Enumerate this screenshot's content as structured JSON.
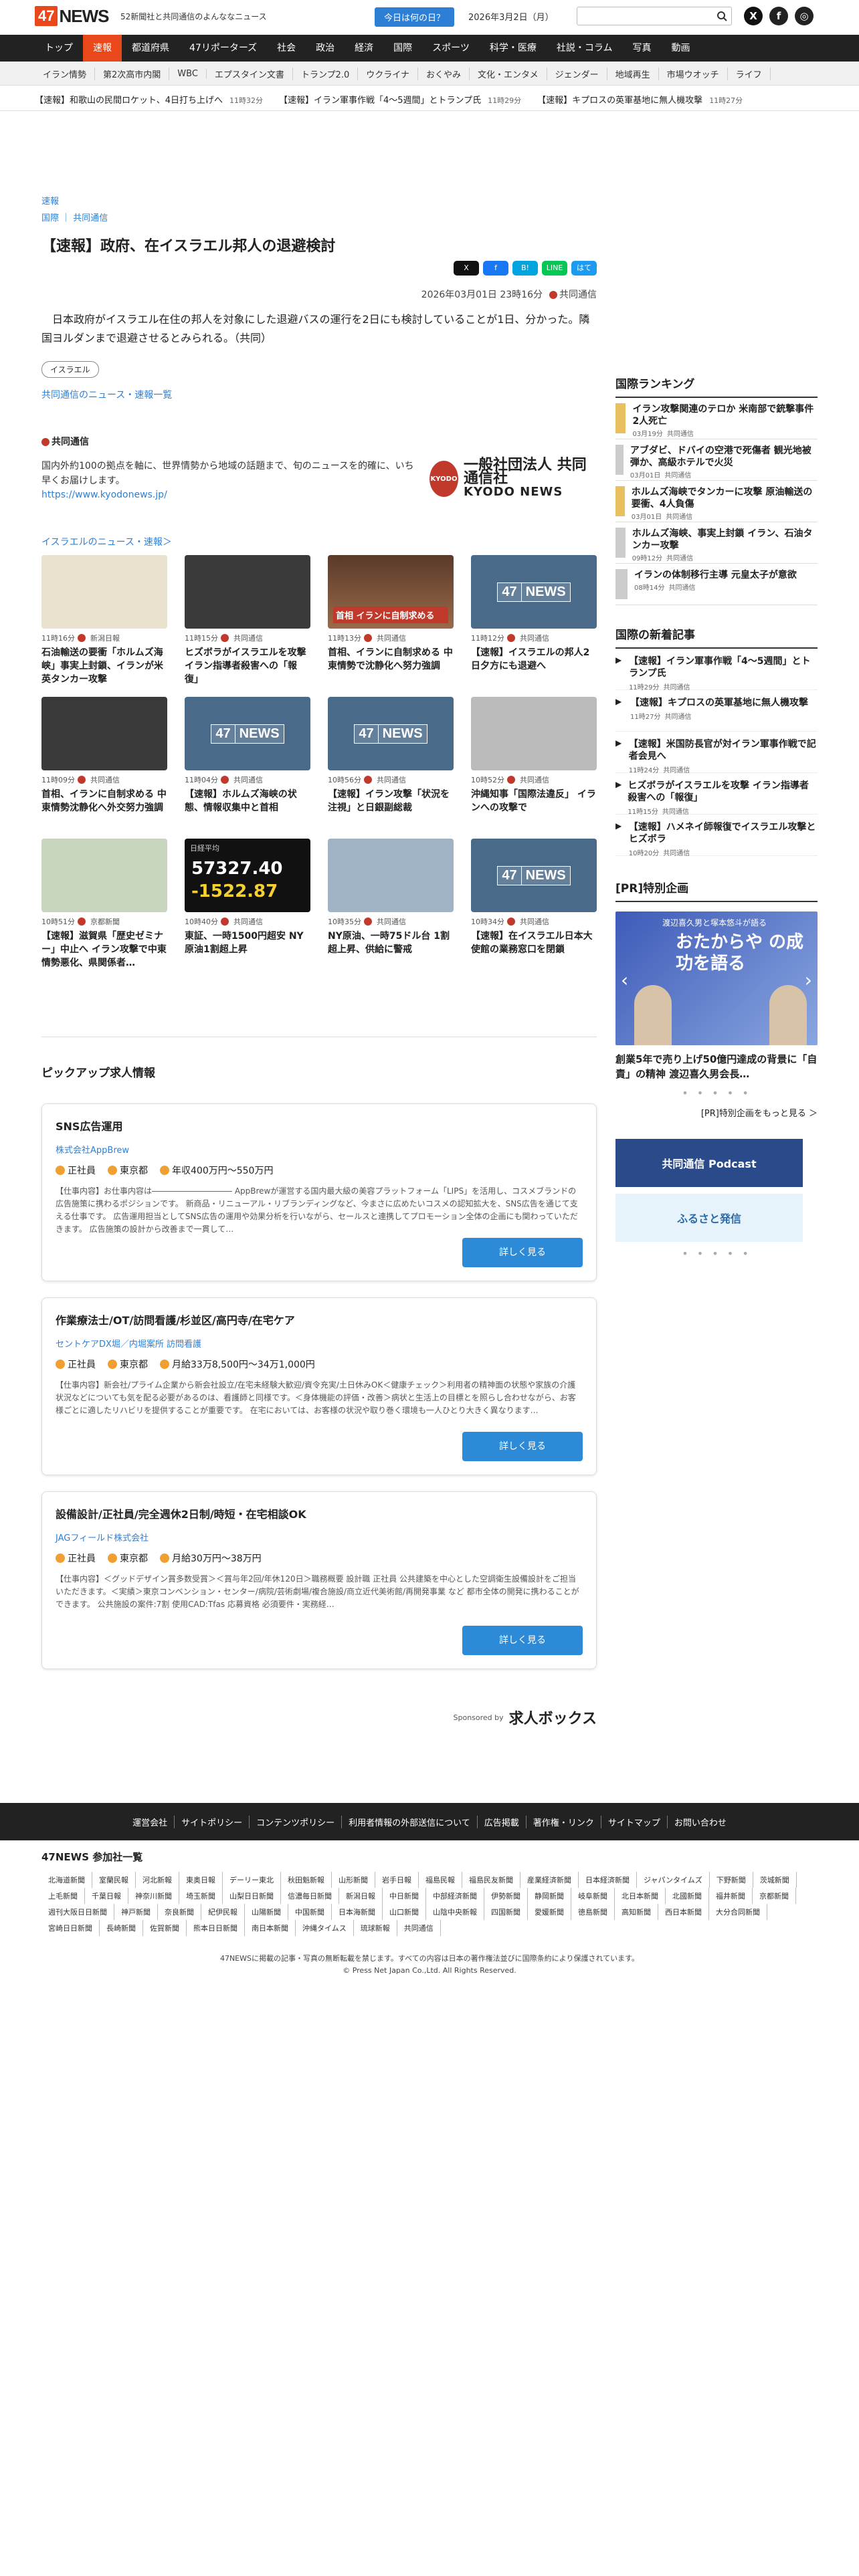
{
  "header": {
    "brand_a": "47",
    "brand_b": "NEWS",
    "tagline": "52新聞社と共同通信のよんななニュース",
    "day_button": "今日は何の日？",
    "date": "2026年3月2日（月）",
    "search_placeholder": ""
  },
  "nav": [
    "トップ",
    "速報",
    "都道府県",
    "47リポーターズ",
    "社会",
    "政治",
    "経済",
    "国際",
    "スポーツ",
    "科学・医療",
    "社説・コラム",
    "写真",
    "動画"
  ],
  "subnav": [
    "イラン情勢",
    "第2次高市内閣",
    "WBC",
    "エプスタイン文書",
    "トランプ2.0",
    "ウクライナ",
    "おくやみ",
    "文化・エンタメ",
    "ジェンダー",
    "地域再生",
    "市場ウオッチ",
    "ライフ"
  ],
  "ticker": [
    {
      "t": "【速報】和歌山の民間ロケット、4日打ち上げへ",
      "tm": "11時32分"
    },
    {
      "t": "【速報】イラン軍事作戦「4～5週間」とトランプ氏",
      "tm": "11時29分"
    },
    {
      "t": "【速報】キプロスの英軍基地に無人機攻撃",
      "tm": "11時27分"
    }
  ],
  "article": {
    "category": "速報",
    "sub_a": "国際",
    "sub_b": "共同通信",
    "title": "【速報】政府、在イスラエル邦人の退避検討",
    "date": "2026年03月01日 23時16分",
    "source": "共同通信",
    "body": "日本政府がイスラエル在住の邦人を対象にした退避バスの運行を2日にも検討していることが1日、分かった。隣国ヨルダンまで退避させるとみられる。（共同）",
    "tag": "イスラエル",
    "news_link": "共同通信のニュース・速報一覧"
  },
  "share": [
    "X",
    "f",
    "B!",
    "LINE",
    "はて"
  ],
  "source_box": {
    "name": "共同通信",
    "desc": "国内外約100の拠点を軸に、世界情勢から地域の話題まで、旬のニュースを的確に、いち早くお届けします。",
    "url": "https://www.kyodonews.jp/",
    "logo_small": "KYODO",
    "logo_a": "一般社団法人 共同通信社",
    "logo_b": "KYODO NEWS"
  },
  "related_title": "イスラエルのニュース・速報＞",
  "related": [
    {
      "time": "11時16分",
      "src": "新潟日報",
      "title": "石油輸送の要衝「ホルムズ海峡」事実上封鎖、イランが米英タンカー攻撃",
      "kind": "map"
    },
    {
      "time": "11時15分",
      "src": "共同通信",
      "title": "ヒズボラがイスラエルを攻撃 イラン指導者殺害への「報復」",
      "kind": "dark"
    },
    {
      "time": "11時13分",
      "src": "共同通信",
      "title": "首相、イランに自制求める 中東情勢で沈静化へ努力強調",
      "kind": "red"
    },
    {
      "time": "11時12分",
      "src": "共同通信",
      "title": "【速報】イスラエルの邦人2日夕方にも退避へ",
      "kind": "logo"
    },
    {
      "time": "11時09分",
      "src": "共同通信",
      "title": "首相、イランに自制求める 中東情勢沈静化へ外交努力強調",
      "kind": "dark"
    },
    {
      "time": "11時04分",
      "src": "共同通信",
      "title": "【速報】ホルムズ海峡の状態、情報収集中と首相",
      "kind": "logo"
    },
    {
      "time": "10時56分",
      "src": "共同通信",
      "title": "【速報】イラン攻撃「状況を注視」と日銀副総裁",
      "kind": "logo"
    },
    {
      "time": "10時52分",
      "src": "共同通信",
      "title": "沖縄知事「国際法違反」 イランへの攻撃で",
      "kind": "gray"
    },
    {
      "time": "10時51分",
      "src": "京都新聞",
      "title": "【速報】滋賀県「歴史ゼミナー」中止へ イラン攻撃で中東情勢悪化、県関係者…",
      "kind": "bldg"
    },
    {
      "time": "10時40分",
      "src": "共同通信",
      "title": "東証、一時1500円超安 NY原油1割超上昇",
      "kind": "stock"
    },
    {
      "time": "10時35分",
      "src": "共同通信",
      "title": "NY原油、一時75ドル台 1割超上昇、供給に警戒",
      "kind": "sea"
    },
    {
      "time": "10時34分",
      "src": "共同通信",
      "title": "【速報】在イスラエル日本大使館の業務窓口を閉鎖",
      "kind": "logo"
    }
  ],
  "stock": {
    "label": "日経平均",
    "a": "57327.40",
    "b": "-1522.87"
  },
  "red_caption": "首相 イランに自制求める",
  "pickup_title": "ピックアップ求人情報",
  "jobs": [
    {
      "title": "SNS広告運用",
      "company": "株式会社AppBrew",
      "type": "正社員",
      "loc": "東京都",
      "pay": "年収400万円～550万円",
      "desc": "【仕事内容】お仕事内容は―――――――――― AppBrewが運営する国内最大級の美容プラットフォーム「LIPS」を活用し、コスメブランドの広告施策に携わるポジションです。 新商品・リニューアル・リブランディングなど、今まさに広めたいコスメの認知拡大を、SNS広告を通じて支える仕事です。 広告運用担当としてSNS広告の運用や効果分析を行いながら、セールスと連携してプロモーション全体の企画にも関わっていただきます。 広告施策の設計から改善まで一貫して…",
      "btn": "詳しく見る"
    },
    {
      "title": "作業療法士/OT/訪問看護/杉並区/高円寺/在宅ケア",
      "company": "セントケアDX堀／内堀案所 訪問看護",
      "type": "正社員",
      "loc": "東京都",
      "pay": "月給33万8,500円～34万1,000円",
      "desc": "【仕事内容】新会社/プライム企業から新会社設立/在宅未経験大歓迎/資令充実/土日休みOK＜健康チェック＞利用者の精神面の状態や家族の介護状況などについても気を配る必要があるのは、看護師と同様です。＜身体機能の評価・改善＞病状と生活上の目標とを照らし合わせながら、お客様ごとに適したリハビリを提供することが重要です。 在宅においては、お客様の状況や取り巻く環境も一人ひとり大きく異なります…",
      "btn": "詳しく見る"
    },
    {
      "title": "設備設計/正社員/完全週休2日制/時短・在宅相談OK",
      "company": "JAGフィールド株式会社",
      "type": "正社員",
      "loc": "東京都",
      "pay": "月給30万円～38万円",
      "desc": "【仕事内容】＜グッドデザイン賞多数受賞＞＜賞与年2回/年休120日＞職務概要 設計職 正社員 公共建築を中心とした空調衛生設備設計をご担当いただきます。＜実績＞東京コンベンション・センター/病院/芸術劇場/複合施設/商立近代美術館/再開発事業 など 都市全体の開発に携わることができます。 公共施設の案件:7割 使用CAD:Tfas 応募資格 必須要件・実務経…",
      "btn": "詳しく見る"
    }
  ],
  "sponsor": {
    "label": "Sponsored by",
    "brand": "求人ボックス"
  },
  "ranking": {
    "title": "国際ランキング",
    "items": [
      {
        "t": "イラン攻撃関連のテロか 米南部で銃撃事件2人死亡",
        "tm": "03月19分",
        "src": "共同通信"
      },
      {
        "t": "アブダビ、ドバイの空港で死傷者 観光地被弾か、高級ホテルで火災",
        "tm": "03月01日",
        "src": "共同通信"
      },
      {
        "t": "ホルムズ海峡でタンカーに攻撃 原油輸送の要衝、4人負傷",
        "tm": "03月01日",
        "src": "共同通信"
      },
      {
        "t": "ホルムズ海峡、事実上封鎖 イラン、石油タンカー攻撃",
        "tm": "09時12分",
        "src": "共同通信"
      },
      {
        "t": "イランの体制移行主導 元皇太子が意欲",
        "tm": "08時14分",
        "src": "共同通信"
      }
    ]
  },
  "latest": {
    "title": "国際の新着記事",
    "items": [
      {
        "t": "【速報】イラン軍事作戦「4～5週間」とトランプ氏",
        "tm": "11時29分",
        "src": "共同通信"
      },
      {
        "t": "【速報】キプロスの英軍基地に無人機攻撃",
        "tm": "11時27分",
        "src": "共同通信"
      },
      {
        "t": "【速報】米国防長官が対イラン軍事作戦で記者会見へ",
        "tm": "11時24分",
        "src": "共同通信"
      },
      {
        "t": "ヒズボラがイスラエルを攻撃 イラン指導者殺害への「報復」",
        "tm": "11時15分",
        "src": "共同通信"
      },
      {
        "t": "【速報】ハメネイ師報復でイスラエル攻撃とヒズボラ",
        "tm": "10時20分",
        "src": "共同通信"
      }
    ]
  },
  "pr": {
    "title": "[PR]特別企画",
    "banner_top": "渡辺喜久男と塚本悠斗が語る",
    "banner": "おたからや の成功を語る",
    "caption": "創業5年で売り上げ50億円達成の背景に「自責」の精神 渡辺喜久男会長…",
    "more": "[PR]特別企画をもっと見る ＞",
    "ad1": "共同通信 Podcast",
    "ad2": "ふるさと発信"
  },
  "footer_links": [
    "運営会社",
    "サイトポリシー",
    "コンテンツポリシー",
    "利用者情報の外部送信について",
    "広告掲載",
    "著作権・リンク",
    "サイトマップ",
    "お問い合わせ"
  ],
  "papers_title": "47NEWS 参加社一覧",
  "papers": [
    "北海道新聞",
    "室蘭民報",
    "河北新報",
    "東奥日報",
    "デーリー東北",
    "秋田魁新報",
    "山形新聞",
    "岩手日報",
    "福島民報",
    "福島民友新聞",
    "産業経済新聞",
    "日本経済新聞",
    "ジャパンタイムズ",
    "下野新聞",
    "茨城新聞",
    "上毛新聞",
    "千葉日報",
    "神奈川新聞",
    "埼玉新聞",
    "山梨日日新聞",
    "信濃毎日新聞",
    "新潟日報",
    "中日新聞",
    "中部経済新聞",
    "伊勢新聞",
    "静岡新聞",
    "岐阜新聞",
    "北日本新聞",
    "北國新聞",
    "福井新聞",
    "京都新聞",
    "週刊大阪日日新聞",
    "神戸新聞",
    "奈良新聞",
    "紀伊民報",
    "山陽新聞",
    "中国新聞",
    "日本海新聞",
    "山口新聞",
    "山陰中央新報",
    "四国新聞",
    "愛媛新聞",
    "徳島新聞",
    "高知新聞",
    "西日本新聞",
    "大分合同新聞",
    "宮崎日日新聞",
    "長崎新聞",
    "佐賀新聞",
    "熊本日日新聞",
    "南日本新聞",
    "沖縄タイムス",
    "琉球新報",
    "共同通信"
  ],
  "copyright_a": "47NEWSに掲載の記事・写真の無断転載を禁じます。すべての内容は日本の著作権法並びに国際条約により保護されています。",
  "copyright_b": "© Press Net Japan Co.,Ltd. All Rights Reserved."
}
